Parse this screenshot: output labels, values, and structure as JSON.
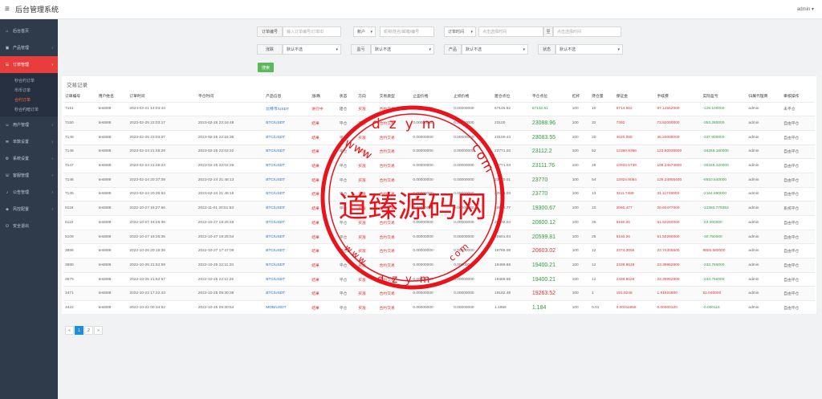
{
  "app": {
    "title": "后台管理系统",
    "user": "admin"
  },
  "sidebar": {
    "items": [
      {
        "label": "后台首页",
        "icon": "home-icon",
        "arrow": false
      },
      {
        "label": "产品管理",
        "icon": "box-icon",
        "arrow": true
      },
      {
        "label": "订单管理",
        "icon": "order-icon",
        "arrow": true,
        "active": true
      },
      {
        "label": "用户管理",
        "icon": "user-icon",
        "arrow": true
      },
      {
        "label": "单数设置",
        "icon": "list-icon",
        "arrow": true
      },
      {
        "label": "系统设置",
        "icon": "gear-icon",
        "arrow": true
      },
      {
        "label": "客服管理",
        "icon": "service-icon",
        "arrow": true
      },
      {
        "label": "公告管理",
        "icon": "bell-icon",
        "arrow": true
      },
      {
        "label": "风控配置",
        "icon": "shield-icon",
        "arrow": true
      },
      {
        "label": "安全退出",
        "icon": "logout-icon",
        "arrow": false
      }
    ],
    "subitems": [
      "秒合约订单",
      "币币订单",
      "合约订单",
      "秒合约暗订单"
    ]
  },
  "filters": {
    "order_no_label": "订单编号",
    "order_no_placeholder": "输入订单编号/订单ID",
    "user_select": "账户",
    "user_placeholder": "昵称/姓名/邮箱/编号",
    "time_select": "订单时间",
    "start_placeholder": "点击选择时间",
    "to_label": "至",
    "end_placeholder": "点击选择时间",
    "direction_label": "涨跌",
    "direction_value": "默认不选",
    "profit_label": "盈亏",
    "profit_value": "默认不选",
    "product_label": "产品",
    "product_value": "默认不选",
    "status_label": "状态",
    "status_value": "默认不选",
    "search_label": "搜索"
  },
  "panel": {
    "title": "交易记录"
  },
  "table": {
    "headers": [
      "订单编号",
      "用户姓名",
      "订单时间",
      "平仓时间",
      "产品信息",
      "涨/跌",
      "状态",
      "方向",
      "交易类型",
      "止盈价格",
      "止损价格",
      "建仓点位",
      "平仓点位",
      "杠杆",
      "持仓量",
      "保证金",
      "手续费",
      "实际盈亏",
      "归属代理商",
      "审核操作"
    ],
    "rows": [
      [
        "7151",
        "test888",
        "2024-03-21 14:03:44",
        "",
        "比特币/USDT",
        "进行中",
        "建仓",
        "买涨",
        "合约交易",
        "0.00000000",
        "0.00000000",
        "67145.62",
        "67132.81",
        "100",
        "10",
        "6714.562",
        "67.14562000",
        "-128.100000",
        "admin",
        "未平仓"
      ],
      [
        "7150",
        "test888",
        "2023-02-25 22:03:17",
        "2023-02-25 22:16:48",
        "BTC/USDT",
        "结果",
        "平仓",
        "买涨",
        "合约交易",
        "0.00000000",
        "0.00000000",
        "23100",
        "23088.96",
        "100",
        "32",
        "7392",
        "73.92000000",
        "-353.280000",
        "admin",
        "自由平仓"
      ],
      [
        "7149",
        "test888",
        "2023-02-25 22:03:07",
        "2023-02-25 22:16:36",
        "BTC/USDT",
        "结果",
        "平仓",
        "买涨",
        "合约交易",
        "0.00000000",
        "0.00000000",
        "23100.44",
        "23083.55",
        "100",
        "20",
        "4620.088",
        "46.20088000",
        "-337.800000",
        "admin",
        "自由平仓"
      ],
      [
        "7148",
        "test888",
        "2023-02-24 21:48:29",
        "2023-02-25 22:02:22",
        "BTC/USDT",
        "结果",
        "平仓",
        "买涨",
        "合约交易",
        "0.00000000",
        "0.00000000",
        "23771.03",
        "23112.2",
        "100",
        "52",
        "12360.9356",
        "123.60935600",
        "-34259.160000",
        "admin",
        "自由平仓"
      ],
      [
        "7147",
        "test888",
        "2023-02-24 21:48:23",
        "2023-02-25 22:02:26",
        "BTC/USDT",
        "结果",
        "平仓",
        "买涨",
        "合约交易",
        "0.00000000",
        "0.00000000",
        "23771.03",
        "23111.76",
        "100",
        "46",
        "10934.6738",
        "109.34673800",
        "-30326.420000",
        "admin",
        "自由平仓"
      ],
      [
        "7146",
        "test888",
        "2023-02-24 20:37:09",
        "2023-02-24 21:48:13",
        "BTC/USDT",
        "结果",
        "平仓",
        "买涨",
        "合约交易",
        "0.00000000",
        "0.00000000",
        "23770.01",
        "23770",
        "100",
        "54",
        "12924.9054",
        "129.24905400",
        "-8910.540000",
        "admin",
        "自由平仓"
      ],
      [
        "7145",
        "test888",
        "2023-02-24 20:36:53",
        "2023-02-24 21:48:16",
        "BTC/USDT",
        "结果",
        "平仓",
        "买涨",
        "合约交易",
        "0.00000000",
        "0.00000000",
        "23938.03",
        "23770",
        "100",
        "13",
        "3111.7489",
        "31.11748900",
        "-2164.890000",
        "admin",
        "自由平仓"
      ],
      [
        "5118",
        "test888",
        "2022-10-27 19:27:56",
        "2022-11-01 20:51:53",
        "BTC/USDT",
        "结果",
        "平仓",
        "买涨",
        "合约交易",
        "0.00000000",
        "0.00000000",
        "20604.77",
        "19300.67",
        "100",
        "10",
        "2060.477",
        "20.60477000",
        "-12350.779353",
        "admin",
        "系统平仓"
      ],
      [
        "5110",
        "test888",
        "2022-10-27 19:25:36",
        "2022-10-27 19:25:48",
        "BTC/USDT",
        "结果",
        "平仓",
        "买涨",
        "合约交易",
        "0.00000000",
        "0.00000000",
        "20602.04",
        "20600.12",
        "100",
        "25",
        "5150.26",
        "51.50260000",
        "-23.000000",
        "admin",
        "自由平仓"
      ],
      [
        "5109",
        "test888",
        "2022-10-27 19:25:35",
        "2022-10-27 19:25:54",
        "BTC/USDT",
        "结果",
        "平仓",
        "买涨",
        "合约交易",
        "0.00000000",
        "0.00000000",
        "20601.04",
        "20599.81",
        "100",
        "25",
        "5150.26",
        "51.50260000",
        "-30.750000",
        "admin",
        "自由平仓"
      ],
      [
        "3868",
        "test888",
        "2022-10-26 20:16:38",
        "2022-10-27 17:47:09",
        "BTC/USDT",
        "结果",
        "平仓",
        "买涨",
        "合约交易",
        "0.00000000",
        "0.00000000",
        "19785.08",
        "20603.02",
        "100",
        "12",
        "2374.3056",
        "23.74305600",
        "9805.680000",
        "admin",
        "自由平仓"
      ],
      [
        "3680",
        "test888",
        "2022-10-25 21:52:59",
        "2022-10-25 22:11:20",
        "BTC/USDT",
        "结果",
        "平仓",
        "买涨",
        "合约交易",
        "0.00000000",
        "0.00000000",
        "19489.69",
        "19400.21",
        "100",
        "12",
        "2339.9628",
        "23.39962800",
        "-233.760000",
        "admin",
        "自由平仓"
      ],
      [
        "3679",
        "test888",
        "2022-10-25 21:52:57",
        "2022-10-25 22:11:26",
        "BTC/USDT",
        "结果",
        "平仓",
        "买涨",
        "合约交易",
        "0.00000000",
        "0.00000000",
        "19489.69",
        "19400.21",
        "100",
        "12",
        "2339.9628",
        "23.39962800",
        "-233.760000",
        "admin",
        "自由平仓"
      ],
      [
        "3471",
        "test888",
        "2022-10-23 17:22:43",
        "2022-10-25 09:30:38",
        "BTC/USDT",
        "结果",
        "平仓",
        "买涨",
        "合约交易",
        "0.00000000",
        "0.00000000",
        "19182.48",
        "19263.52",
        "100",
        "1",
        "191.8248",
        "1.91824800",
        "81.040000",
        "admin",
        "自由平仓"
      ],
      [
        "3422",
        "test888",
        "2022-10-22 00:34:52",
        "2022-10-25 09:30:54",
        "MOB/USDT",
        "结果",
        "平仓",
        "买涨",
        "合约交易",
        "0.00000000",
        "0.00000000",
        "1.1956",
        "1.184",
        "100",
        "0.01",
        "0.00011956",
        "0.00000120",
        "-0.000116",
        "admin",
        "自由平仓"
      ]
    ]
  },
  "pager": {
    "prev": "«",
    "pages": [
      "1",
      "2"
    ],
    "next": "»"
  },
  "watermark": {
    "main": "道臻源码网",
    "top_letters": "dzym",
    "bottom_letters": "dzym",
    "left_letters": "www",
    "right_letters": "com",
    "color": "#e8131b"
  }
}
